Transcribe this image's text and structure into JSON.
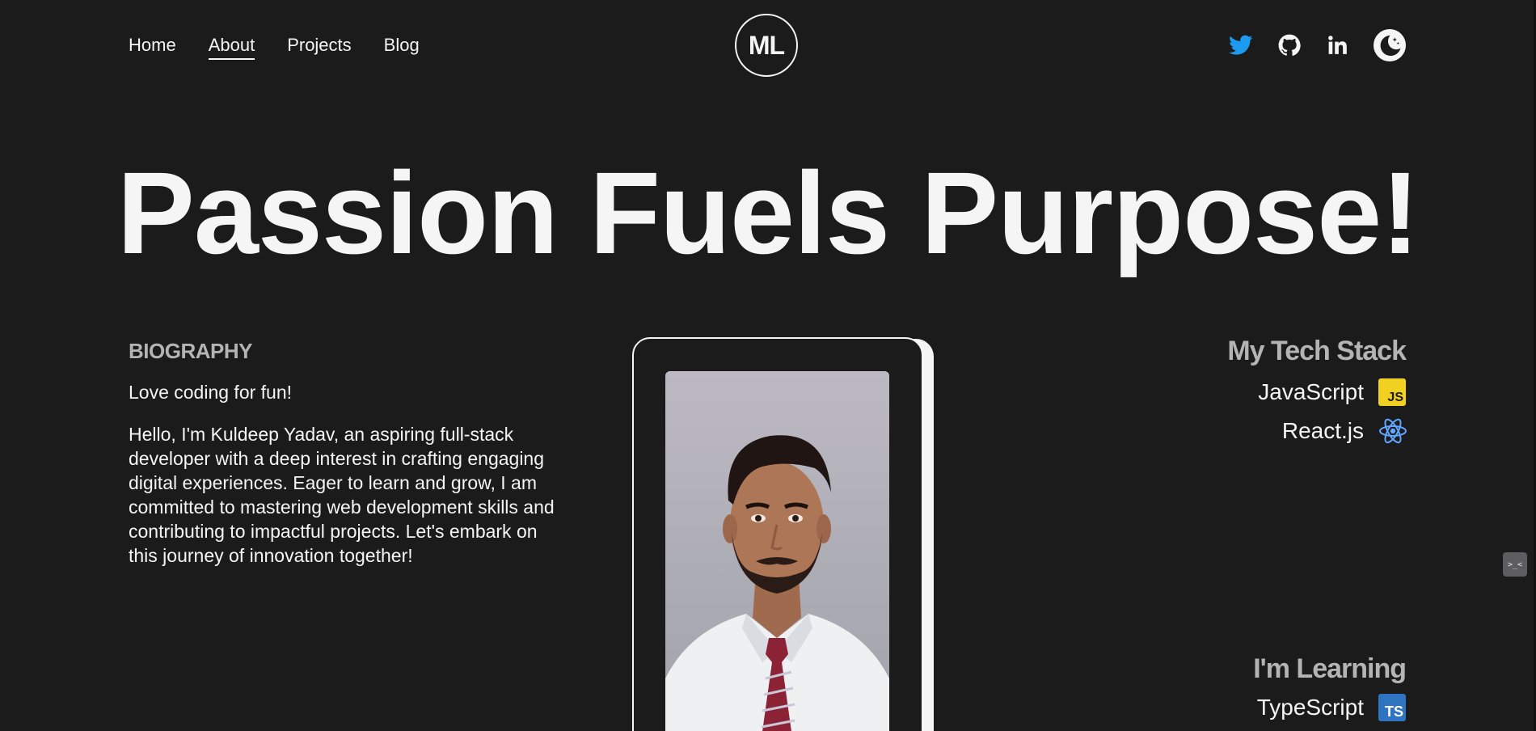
{
  "nav": {
    "items": [
      {
        "label": "Home"
      },
      {
        "label": "About"
      },
      {
        "label": "Projects"
      },
      {
        "label": "Blog"
      }
    ]
  },
  "logo": {
    "text": "ML"
  },
  "social": {
    "icons": [
      "twitter-icon",
      "github-icon",
      "linkedin-icon",
      "moon-sun-icon"
    ],
    "colors": {
      "twitter": "#1d9bf0",
      "react": "#61a7ff",
      "js": "#f0d021",
      "ts": "#2f74c0"
    }
  },
  "hero": {
    "title": "Passion Fuels Purpose!"
  },
  "biography": {
    "heading": "BIOGRAPHY",
    "tagline": "Love coding for fun!",
    "text": "Hello, I'm Kuldeep Yadav, an aspiring full-stack developer with a deep interest in crafting engaging digital experiences. Eager to learn and grow, I am committed to mastering web development skills and contributing to impactful projects. Let's embark on this journey of innovation together!"
  },
  "tech_stack": {
    "heading": "My Tech Stack",
    "items": [
      {
        "label": "JavaScript",
        "badge": "JS"
      },
      {
        "label": "React.js"
      }
    ]
  },
  "learning": {
    "heading": "I'm Learning",
    "items": [
      {
        "label": "TypeScript",
        "badge": "TS"
      }
    ]
  },
  "floating_button": {
    "icon": "dev-tools-icon",
    "text": ">_<"
  }
}
